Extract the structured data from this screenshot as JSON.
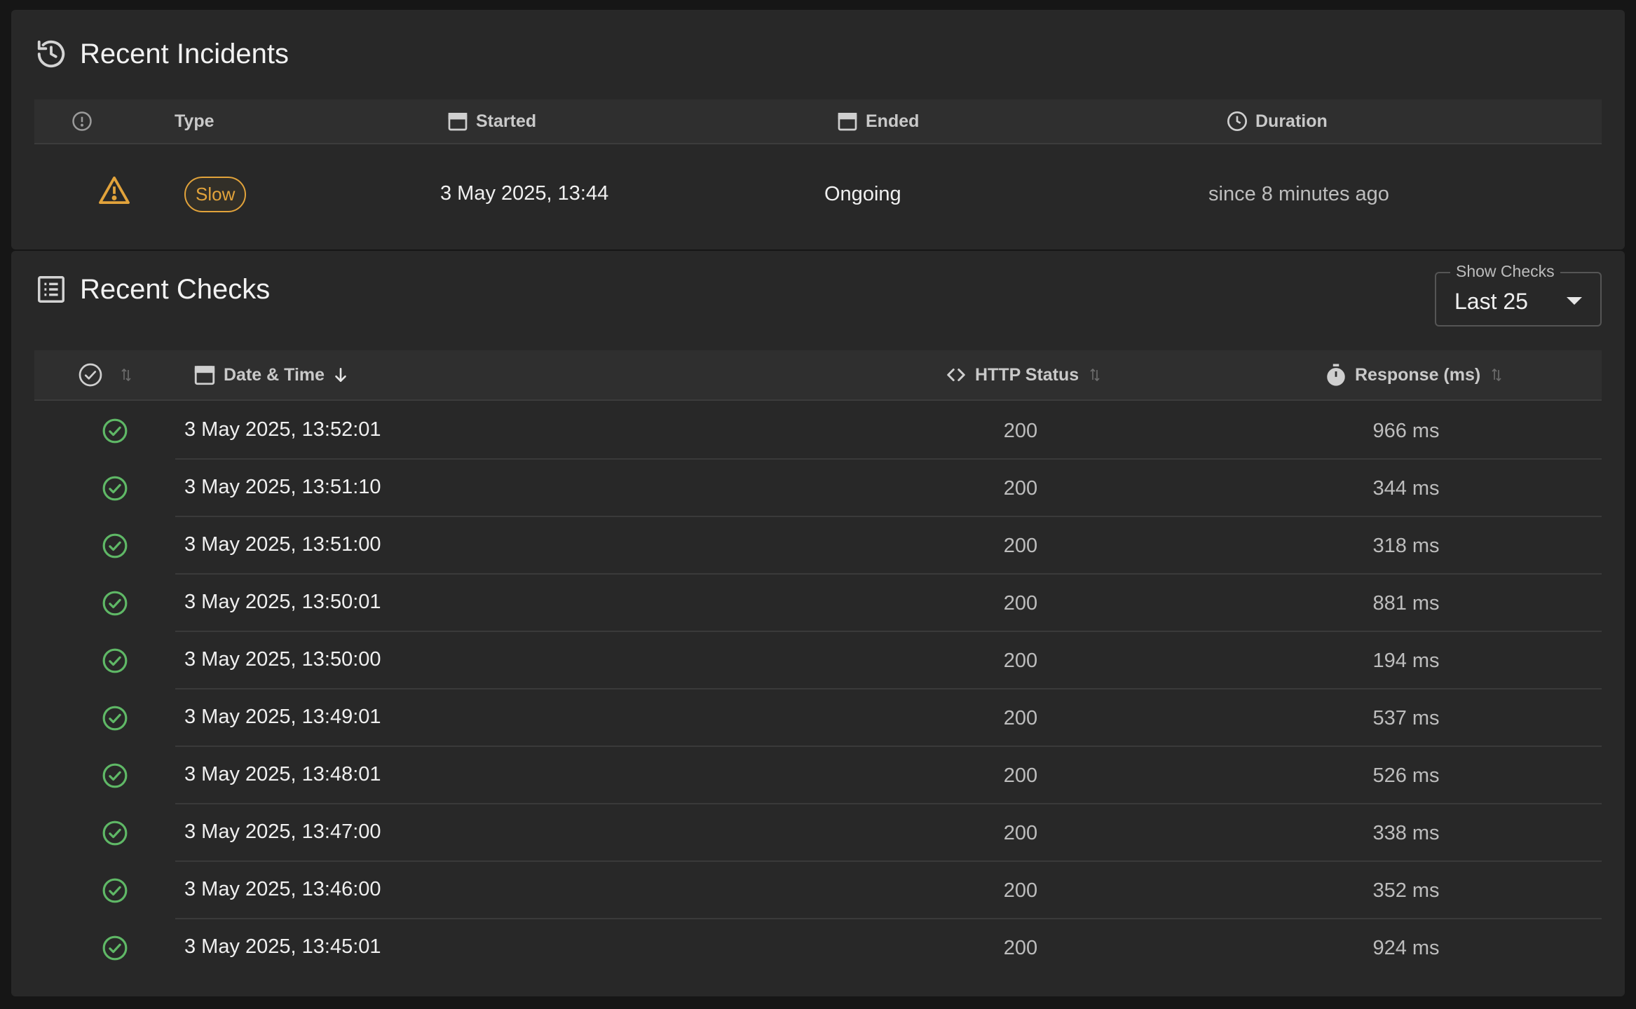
{
  "incidents": {
    "title": "Recent Incidents",
    "columns": {
      "type": "Type",
      "started": "Started",
      "ended": "Ended",
      "duration": "Duration"
    },
    "rows": [
      {
        "icon": "warning-icon",
        "type": "Slow",
        "started": "3 May 2025, 13:44",
        "ended": "Ongoing",
        "duration": "since 8 minutes ago"
      }
    ]
  },
  "checks": {
    "title": "Recent Checks",
    "show_checks": {
      "label": "Show Checks",
      "value": "Last 25"
    },
    "columns": {
      "date_time": "Date & Time",
      "http_status": "HTTP Status",
      "response": "Response (ms)"
    },
    "rows": [
      {
        "datetime": "3 May 2025, 13:52:01",
        "http": "200",
        "response": "966 ms"
      },
      {
        "datetime": "3 May 2025, 13:51:10",
        "http": "200",
        "response": "344 ms"
      },
      {
        "datetime": "3 May 2025, 13:51:00",
        "http": "200",
        "response": "318 ms"
      },
      {
        "datetime": "3 May 2025, 13:50:01",
        "http": "200",
        "response": "881 ms"
      },
      {
        "datetime": "3 May 2025, 13:50:00",
        "http": "200",
        "response": "194 ms"
      },
      {
        "datetime": "3 May 2025, 13:49:01",
        "http": "200",
        "response": "537 ms"
      },
      {
        "datetime": "3 May 2025, 13:48:01",
        "http": "200",
        "response": "526 ms"
      },
      {
        "datetime": "3 May 2025, 13:47:00",
        "http": "200",
        "response": "338 ms"
      },
      {
        "datetime": "3 May 2025, 13:46:00",
        "http": "200",
        "response": "352 ms"
      },
      {
        "datetime": "3 May 2025, 13:45:01",
        "http": "200",
        "response": "924 ms"
      }
    ]
  },
  "colors": {
    "background": "#161616",
    "panel": "#282828",
    "slow_badge": "#e2a33b",
    "success": "#5fb866"
  }
}
